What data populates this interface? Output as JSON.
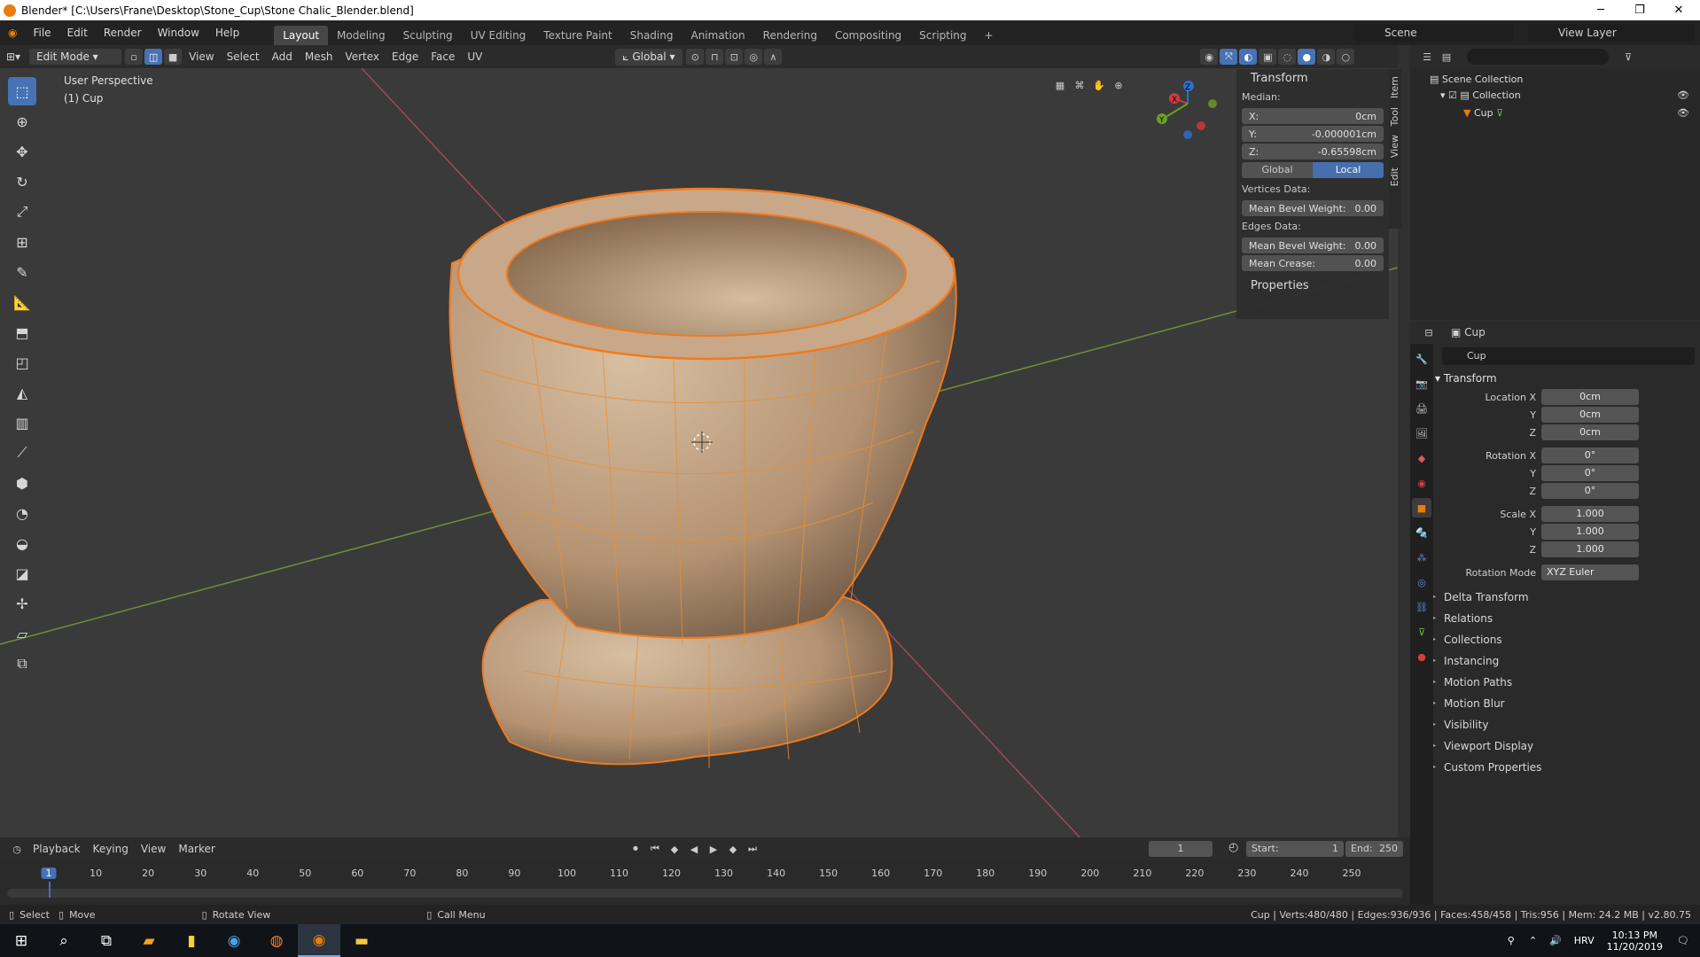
{
  "window": {
    "title": "Blender* [C:\\Users\\Frane\\Desktop\\Stone_Cup\\Stone Chalic_Blender.blend]",
    "minimize": "─",
    "maximize": "❐",
    "close": "✕"
  },
  "menu": {
    "items": [
      "File",
      "Edit",
      "Render",
      "Window",
      "Help"
    ],
    "workspaces": [
      "Layout",
      "Modeling",
      "Sculpting",
      "UV Editing",
      "Texture Paint",
      "Shading",
      "Animation",
      "Rendering",
      "Compositing",
      "Scripting"
    ],
    "add_tab": "+",
    "scene_label": "Scene",
    "view_layer_label": "View Layer"
  },
  "viewport_header": {
    "mode": "Edit Mode",
    "menus": [
      "View",
      "Select",
      "Add",
      "Mesh",
      "Vertex",
      "Edge",
      "Face",
      "UV"
    ],
    "orientation": "Global"
  },
  "viewport": {
    "perspective": "User Perspective",
    "object": "(1) Cup",
    "gizmo": {
      "x": "X",
      "y": "Y",
      "z": "Z"
    }
  },
  "npanel": {
    "title": "Transform",
    "median_label": "Median:",
    "x_label": "X:",
    "x_value": "0cm",
    "y_label": "Y:",
    "y_value": "-0.000001cm",
    "z_label": "Z:",
    "z_value": "-0.65598cm",
    "global": "Global",
    "local": "Local",
    "vertices_data": "Vertices Data:",
    "vertices_bevel_label": "Mean Bevel Weight:",
    "vertices_bevel": "0.00",
    "edges_data": "Edges Data:",
    "edges_bevel_label": "Mean Bevel Weight:",
    "edges_bevel": "0.00",
    "crease_label": "Mean Crease:",
    "crease": "0.00",
    "properties": "Properties",
    "tabs": [
      "Item",
      "Tool",
      "View",
      "Edit"
    ]
  },
  "outliner": {
    "root": "Scene Collection",
    "collection": "Collection",
    "object": "Cup"
  },
  "properties": {
    "header_object": "Cup",
    "object_name": "Cup",
    "transform": "Transform",
    "location_x_label": "Location X",
    "location_x": "0cm",
    "y_label": "Y",
    "location_y": "0cm",
    "z_label": "Z",
    "location_z": "0cm",
    "rotation_x_label": "Rotation X",
    "rotation_x": "0°",
    "rotation_y": "0°",
    "rotation_z": "0°",
    "scale_x_label": "Scale X",
    "scale_x": "1.000",
    "scale_y": "1.000",
    "scale_z": "1.000",
    "rotation_mode_label": "Rotation Mode",
    "rotation_mode": "XYZ Euler",
    "sections": [
      "Delta Transform",
      "Relations",
      "Collections",
      "Instancing",
      "Motion Paths",
      "Motion Blur",
      "Visibility",
      "Viewport Display",
      "Custom Properties"
    ]
  },
  "timeline": {
    "menus": [
      "Playback",
      "Keying",
      "View",
      "Marker"
    ],
    "current_frame": "1",
    "start_label": "Start:",
    "start": "1",
    "end_label": "End:",
    "end": "250",
    "ticks": [
      "1",
      "10",
      "20",
      "30",
      "40",
      "50",
      "60",
      "70",
      "80",
      "90",
      "100",
      "110",
      "120",
      "130",
      "140",
      "150",
      "160",
      "170",
      "180",
      "190",
      "200",
      "210",
      "220",
      "230",
      "240",
      "250"
    ]
  },
  "statusbar": {
    "select": "Select",
    "move": "Move",
    "rotate": "Rotate View",
    "call_menu": "Call Menu",
    "stats": "Cup | Verts:480/480 | Edges:936/936 | Faces:458/458 | Tris:956 | Mem: 24.2 MB | v2.80.75"
  },
  "taskbar": {
    "lang": "HRV",
    "time": "10:13 PM",
    "date": "11/20/2019"
  }
}
